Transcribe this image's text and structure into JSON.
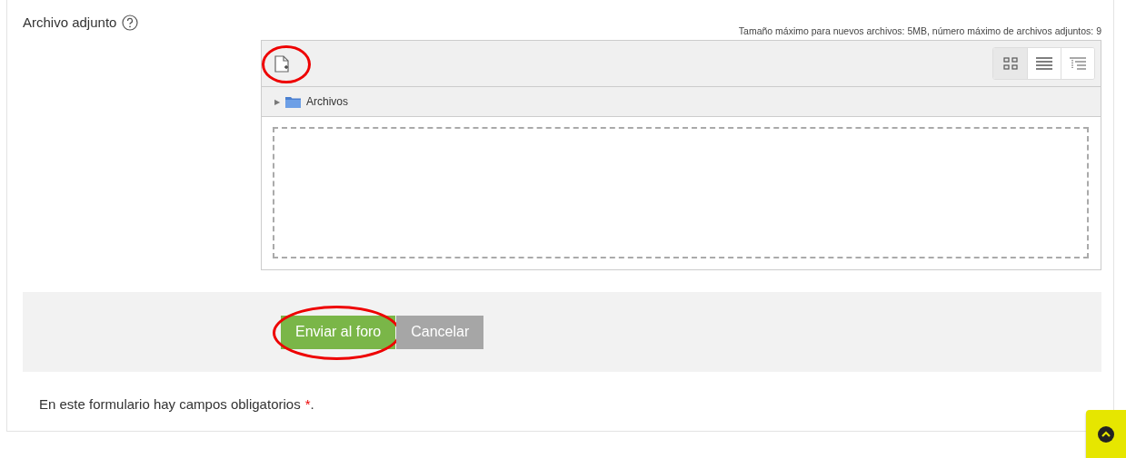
{
  "field": {
    "label": "Archivo adjunto",
    "limits": "Tamaño máximo para nuevos archivos: 5MB, número máximo de archivos adjuntos: 9"
  },
  "filemanager": {
    "view_buttons": [
      {
        "kind": "icons",
        "selected": true
      },
      {
        "kind": "list",
        "selected": false
      },
      {
        "kind": "tree",
        "selected": false
      }
    ],
    "path": [
      {
        "arrow": "▶",
        "label": "Archivos"
      }
    ]
  },
  "buttons": [
    {
      "label": "Enviar al foro",
      "kind": "primary",
      "highlighted": true
    },
    {
      "label": "Cancelar",
      "kind": "secondary",
      "highlighted": false
    }
  ],
  "note": {
    "text": "En este formulario hay campos obligatorios",
    "required_mark": "*",
    "end": "."
  },
  "add_file_highlighted": true
}
